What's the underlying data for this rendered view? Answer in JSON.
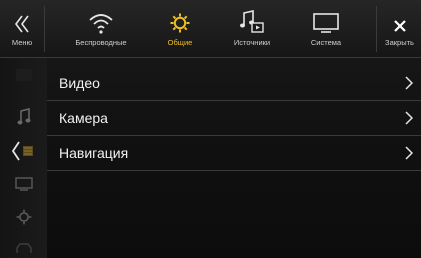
{
  "topbar": {
    "menu_label": "Меню",
    "tabs": [
      {
        "label": "Беспроводные",
        "icon": "wifi-icon",
        "active": false
      },
      {
        "label": "Общие",
        "icon": "gear-icon",
        "active": true
      },
      {
        "label": "Источники",
        "icon": "music-source-icon",
        "active": false
      },
      {
        "label": "Система",
        "icon": "monitor-icon",
        "active": false
      }
    ],
    "close_label": "Закрыть"
  },
  "menu": {
    "items": [
      {
        "label": "Видео"
      },
      {
        "label": "Камера"
      },
      {
        "label": "Навигация"
      }
    ]
  },
  "colors": {
    "accent": "#f0c020",
    "text": "#f2f2f2",
    "rail_icon": "#6a6a6a"
  }
}
